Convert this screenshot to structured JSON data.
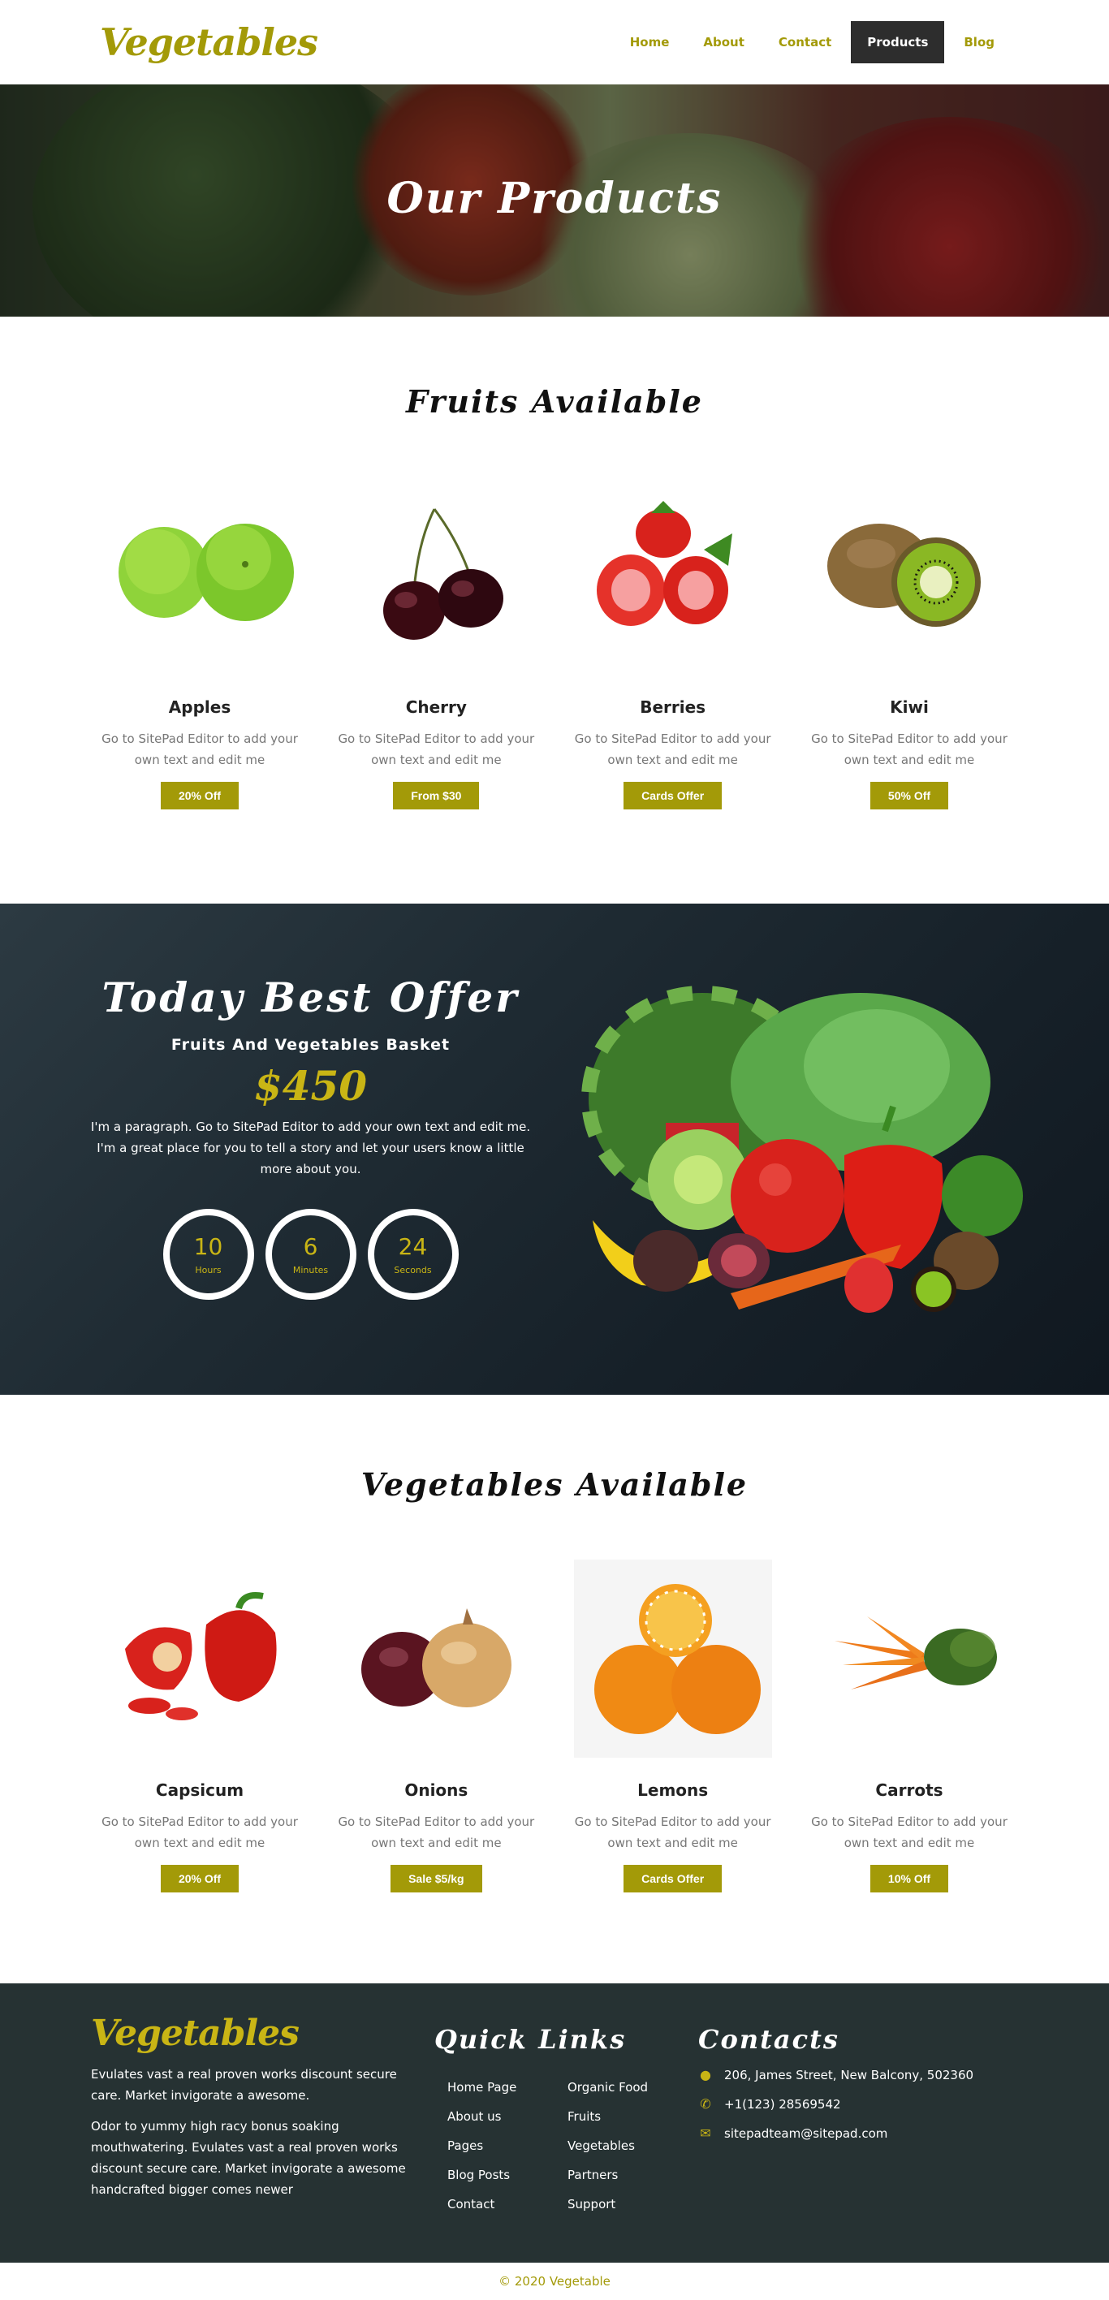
{
  "header": {
    "logo": "Vegetables",
    "nav": [
      "Home",
      "About",
      "Contact",
      "Products",
      "Blog"
    ],
    "active_nav": "Products"
  },
  "hero": {
    "title": "Our Products"
  },
  "fruits": {
    "title": "Fruits Available",
    "items": [
      {
        "name": "Apples",
        "desc": "Go to SitePad Editor to add your own text and edit me",
        "badge": "20% Off"
      },
      {
        "name": "Cherry",
        "desc": "Go to SitePad Editor to add your own text and edit me",
        "badge": "From $30"
      },
      {
        "name": "Berries",
        "desc": "Go to SitePad Editor to add your own text and edit me",
        "badge": "Cards Offer"
      },
      {
        "name": "Kiwi",
        "desc": "Go to SitePad Editor to add your own text and edit me",
        "badge": "50% Off"
      }
    ]
  },
  "offer": {
    "title": "Today Best Offer",
    "subtitle": "Fruits And Vegetables Basket",
    "price": "$450",
    "text": "I'm a paragraph. Go to SitePad Editor to add your own text and edit me. I'm a great place for you to tell a story and let your users know a little more about you.",
    "timers": [
      {
        "value": "10",
        "label": "Hours"
      },
      {
        "value": "6",
        "label": "Minutes"
      },
      {
        "value": "24",
        "label": "Seconds"
      }
    ]
  },
  "vegetables": {
    "title": "Vegetables Available",
    "items": [
      {
        "name": "Capsicum",
        "desc": "Go to SitePad Editor to add your own text and edit me",
        "badge": "20% Off"
      },
      {
        "name": "Onions",
        "desc": "Go to SitePad Editor to add your own text and edit me",
        "badge": "Sale $5/kg"
      },
      {
        "name": "Lemons",
        "desc": "Go to SitePad Editor to add your own text and edit me",
        "badge": "Cards Offer"
      },
      {
        "name": "Carrots",
        "desc": "Go to SitePad Editor to add your own text and edit me",
        "badge": "10% Off"
      }
    ]
  },
  "footer": {
    "logo": "Vegetables",
    "para1": "Evulates vast a real proven works discount secure care. Market invigorate a awesome.",
    "para2": "Odor to yummy high racy bonus soaking mouthwatering. Evulates vast a real proven works discount secure care. Market invigorate a awesome handcrafted bigger comes newer",
    "quick_title": "Quick Links",
    "links_col1": [
      "Home Page",
      "About us",
      "Pages",
      "Blog Posts",
      "Contact"
    ],
    "links_col2": [
      "Organic Food",
      "Fruits",
      "Vegetables",
      "Partners",
      "Support"
    ],
    "contacts_title": "Contacts",
    "address": "206, James Street, New Balcony, 502360",
    "phone": "+1(123) 28569542",
    "email": "sitepadteam@sitepad.com",
    "copyright": "© 2020 Vegetable"
  },
  "colors": {
    "accent": "#a39a08",
    "dark": "#2d2d2d",
    "footer_bg": "#263233"
  }
}
